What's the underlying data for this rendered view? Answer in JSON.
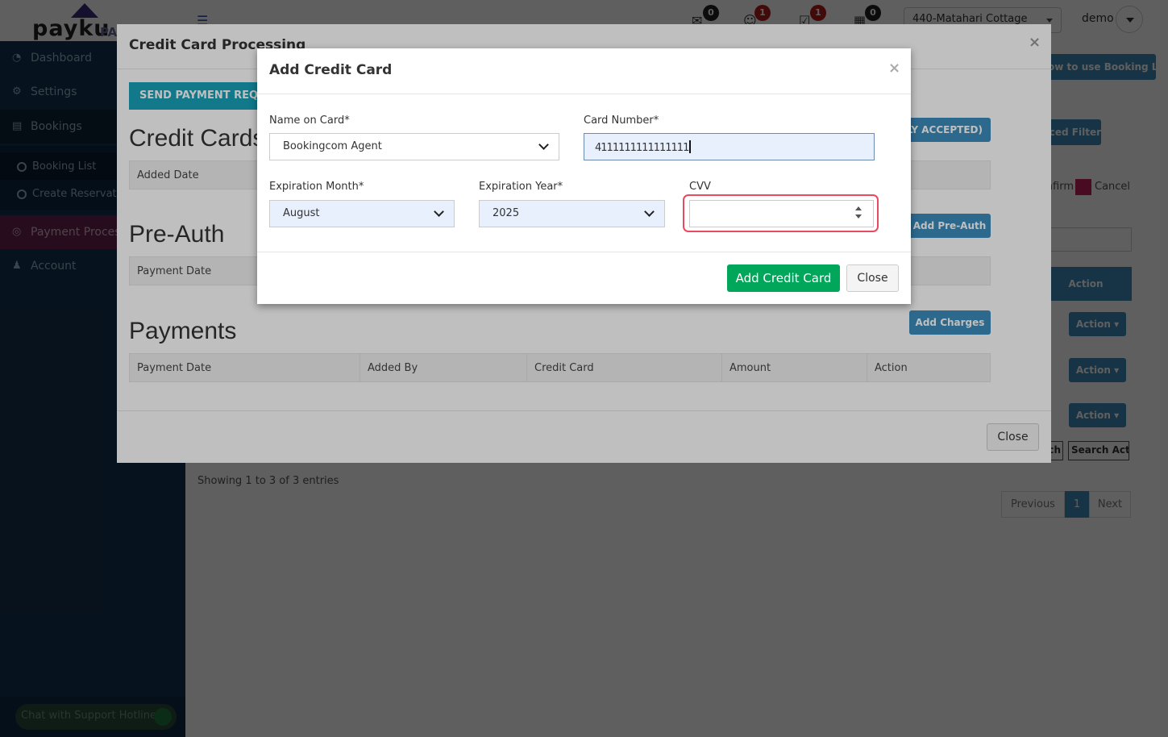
{
  "app": {
    "logo_text": "payku",
    "logo_suffix": "PA",
    "notifications": [
      {
        "icon": "envelope-icon",
        "count": "0",
        "badge_color": "#222222"
      },
      {
        "icon": "people-icon",
        "count": "1",
        "badge_color": "#b51c1c"
      },
      {
        "icon": "checklist-icon",
        "count": "1",
        "badge_color": "#b51c1c"
      },
      {
        "icon": "calendar-icon",
        "count": "0",
        "badge_color": "#222222"
      }
    ],
    "property_select": "440-Matahari Cottage",
    "username": "demo"
  },
  "sidebar": {
    "items": [
      {
        "label": "Dashboard",
        "icon": "dashboard-icon"
      },
      {
        "label": "Settings",
        "icon": "gear-icon"
      },
      {
        "label": "Bookings",
        "icon": "list-icon"
      },
      {
        "label": "Payment Process",
        "icon": "cog-icon"
      },
      {
        "label": "Account",
        "icon": "user-icon"
      }
    ],
    "sub_items": [
      {
        "label": "Booking List"
      },
      {
        "label": "Create Reservation"
      }
    ],
    "chat_label": "Chat with Support Hotline"
  },
  "background": {
    "booking_list_btn": "How to use Booking List",
    "advanced_filter": "Advanced Filter",
    "confirm_label": "Confirm",
    "cancel_label": "Cancel",
    "action_header": "Action",
    "action_btn": "Action",
    "search_btn_1": "Search",
    "search_btn_2": "Search Action",
    "showing": "Showing 1 to 3 of 3 entries",
    "pager": {
      "prev": "Previous",
      "page": "1",
      "next": "Next"
    }
  },
  "credit_modal": {
    "title": "Credit Card Processing",
    "send_btn": "SEND PAYMENT REQUEST",
    "accepted_btn": "ADD CREDIT CARD (ONLY ACCEPTED)",
    "credit_cards_title": "Credit Cards",
    "credit_cards_cols": [
      "Added Date"
    ],
    "preauth_title": "Pre-Auth",
    "preauth_btn": "Add Pre-Auth",
    "preauth_cols": [
      "Payment Date"
    ],
    "payments_title": "Payments",
    "charges_btn": "Add Charges",
    "payments_cols": [
      "Payment Date",
      "Added By",
      "Credit Card",
      "Amount",
      "Action"
    ],
    "close_btn": "Close",
    "close_x": "×"
  },
  "add_card_modal": {
    "title": "Add Credit Card",
    "close_x": "×",
    "name_label": "Name on Card*",
    "name_value": "Bookingcom Agent",
    "number_label": "Card Number*",
    "number_value": "4111111111111111",
    "month_label": "Expiration Month*",
    "month_value": "August",
    "year_label": "Expiration Year*",
    "year_value": "2025",
    "cvv_label": "CVV",
    "cvv_value": "",
    "submit_btn": "Add Credit Card",
    "close_btn": "Close",
    "colors": {
      "submit": "#00a65a",
      "highlight": "#e84b5f",
      "autofill": "#e8f0fe"
    }
  }
}
